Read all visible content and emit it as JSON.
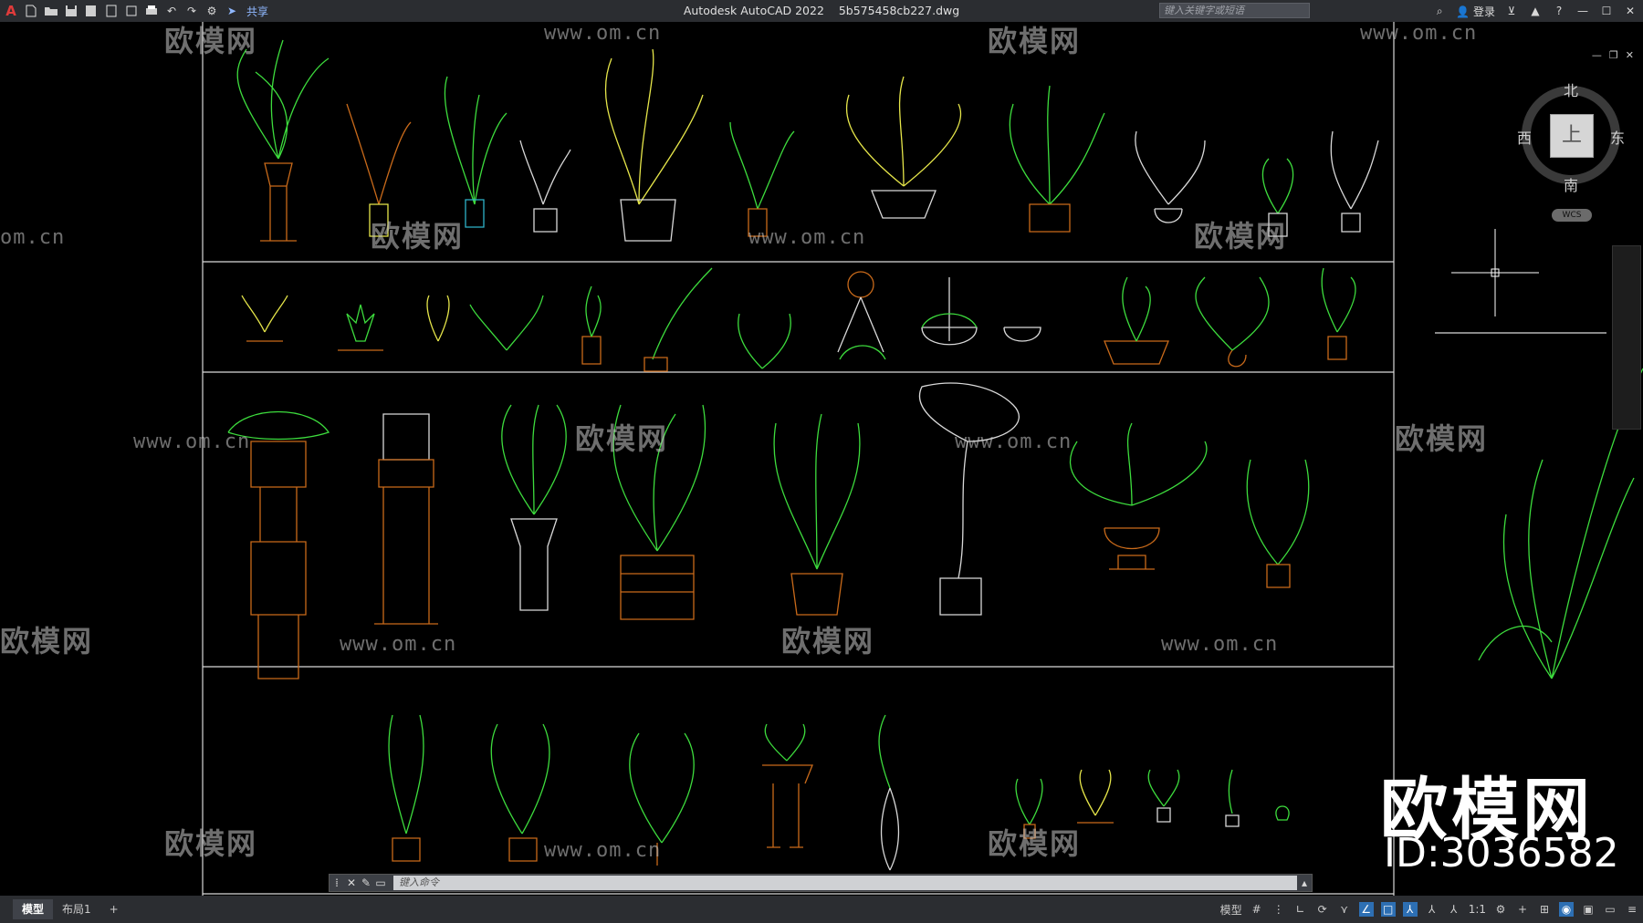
{
  "titlebar": {
    "app_name": "Autodesk AutoCAD 2022",
    "file_name": "5b575458cb227.dwg",
    "share_label": "共享",
    "search_placeholder": "键入关键字或短语",
    "login_label": "登录",
    "app_logo": "A"
  },
  "viewcube": {
    "north": "北",
    "south": "南",
    "east": "东",
    "west": "西",
    "top_face": "上",
    "wcs_label": "WCS"
  },
  "command_line": {
    "placeholder": "键入命令"
  },
  "layout_tabs": [
    {
      "label": "模型",
      "active": true
    },
    {
      "label": "布局1",
      "active": false
    },
    {
      "label": "+",
      "active": false
    }
  ],
  "status_bar": {
    "model_label": "模型",
    "scale_label": "1:1"
  },
  "watermarks": {
    "url": "www.om.cn",
    "url_partial_left": "om.cn",
    "brand": "欧模网",
    "brand_big": "欧模网",
    "brand_id": "ID:3036582"
  },
  "colors": {
    "background": "#000000",
    "plant_green": "#3ddc3d",
    "pot_orange": "#c96a1a",
    "line_white": "#d9d9d9",
    "accent_yellow": "#e6e64a"
  }
}
